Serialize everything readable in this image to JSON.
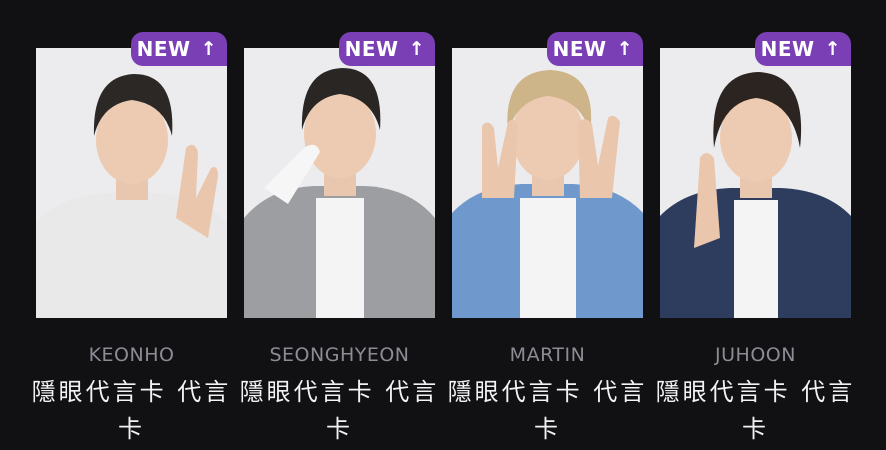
{
  "colors": {
    "background": "#111113",
    "badge": "#7a3fb5",
    "name_text": "#8b8c94",
    "title_text": "#f2f2f4"
  },
  "cards": [
    {
      "badge_text": "NEW",
      "badge_icon": "arrow-up-icon",
      "member": "KEONHO",
      "title": "隱眼代言卡 代言卡",
      "top_color": "#e9e9e9",
      "hair_color": "#2c2826"
    },
    {
      "badge_text": "NEW",
      "badge_icon": "arrow-up-icon",
      "member": "SEONGHYEON",
      "title": "隱眼代言卡 代言卡",
      "top_color": "#9c9ea2",
      "hair_color": "#2a2624"
    },
    {
      "badge_text": "NEW",
      "badge_icon": "arrow-up-icon",
      "member": "MARTIN",
      "title": "隱眼代言卡 代言卡",
      "top_color": "#6f98cc",
      "hair_color": "#cdb489"
    },
    {
      "badge_text": "NEW",
      "badge_icon": "arrow-up-icon",
      "member": "JUHOON",
      "title": "隱眼代言卡 代言卡",
      "top_color": "#2e3d5e",
      "hair_color": "#2b2420"
    }
  ]
}
